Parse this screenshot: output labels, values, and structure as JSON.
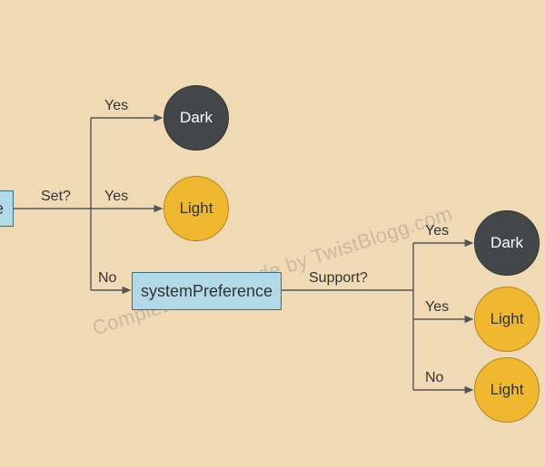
{
  "watermark": "Complete Dark mode by TwistBlogg.com",
  "nodes": {
    "storage": {
      "label": "e"
    },
    "systemPreference": {
      "label": "systemPreference"
    },
    "dark1": {
      "label": "Dark"
    },
    "light1": {
      "label": "Light"
    },
    "dark2": {
      "label": "Dark"
    },
    "light2": {
      "label": "Light"
    },
    "light3": {
      "label": "Light"
    }
  },
  "edges": {
    "setQuestion": "Set?",
    "setYes1": "Yes",
    "setYes2": "Yes",
    "setNo": "No",
    "supportQuestion": "Support?",
    "supportYes1": "Yes",
    "supportYes2": "Yes",
    "supportNo": "No"
  }
}
